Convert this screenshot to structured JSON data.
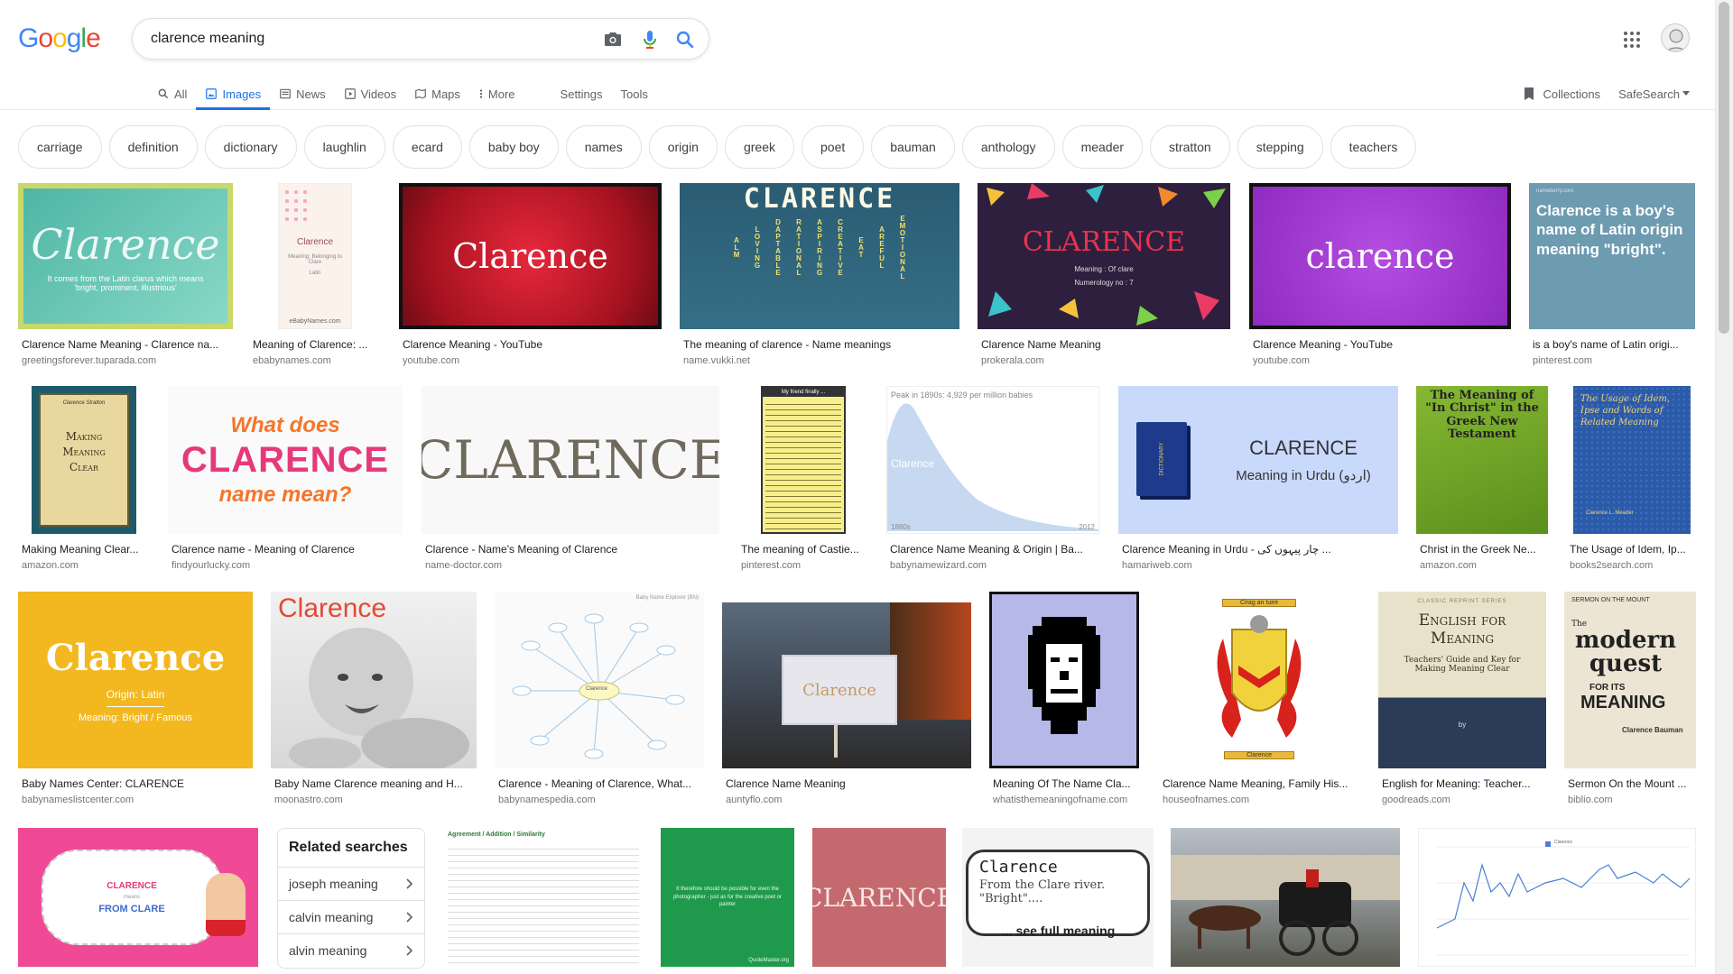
{
  "logo": {
    "letters": [
      "G",
      "o",
      "o",
      "g",
      "l",
      "e"
    ],
    "colors": [
      "#4285f4",
      "#ea4335",
      "#fbbc05",
      "#4285f4",
      "#34a853",
      "#ea4335"
    ]
  },
  "search": {
    "query": "clarence meaning"
  },
  "icons": {
    "camera": "camera-icon",
    "mic": "mic-icon",
    "search": "search-icon",
    "apps": "apps-grid-icon"
  },
  "tabs": [
    {
      "label": "All",
      "icon": "search-icon"
    },
    {
      "label": "Images",
      "icon": "image-icon",
      "active": true
    },
    {
      "label": "News",
      "icon": "news-icon"
    },
    {
      "label": "Videos",
      "icon": "video-icon"
    },
    {
      "label": "Maps",
      "icon": "map-icon"
    },
    {
      "label": "More",
      "icon": "more-icon"
    }
  ],
  "settings_label": "Settings",
  "tools_label": "Tools",
  "collections_label": "Collections",
  "safesearch_label": "SafeSearch",
  "chips": [
    "carriage",
    "definition",
    "dictionary",
    "laughlin",
    "ecard",
    "baby boy",
    "names",
    "origin",
    "greek",
    "poet",
    "bauman",
    "anthology",
    "meader",
    "stratton",
    "stepping",
    "teachers"
  ],
  "thumbs": {
    "t1_main": "Clarence",
    "t1_sub": "It comes from the Latin clarus which means 'bright, prominent, illustrious'",
    "t2_main": "Clarence",
    "t2_sub": "Meaning: Belonging to Clare",
    "t2_origin": "Latin",
    "t2_brand": "eBabyNames.com",
    "t3_main": "Clarence",
    "t4_main": "CLARENCE",
    "t4_cols": [
      "ALM",
      "LOVING",
      "DAPTABLE",
      "RATIONAL",
      "ASPIRING",
      "CREATIVE",
      "EAT",
      "AREFUL",
      "EMOTIONAL"
    ],
    "t5_main": "CLARENCE",
    "t5_l1": "Meaning : Of clare",
    "t5_l2": "Numerology no : 7",
    "t6_main": "clarence",
    "t7_brand": "nameberry.com",
    "t7_main": "Clarence is a boy's name of Latin origin meaning \"bright\".",
    "t8_series": "Clarence Stratton",
    "t8_main": "Making Meaning Clear",
    "t9_l1": "What does",
    "t9_l2": "CLARENCE",
    "t9_l3": "name mean?",
    "t10_main": "CLARENCE",
    "t11_head": "My friend finally ...",
    "t12_top": "Peak in 1890s: 4,929 per million babies",
    "t12_name": "Clarence",
    "t12_x0": "1880s",
    "t12_x1": "2012",
    "t13_main": "CLARENCE",
    "t13_sub": "Meaning in Urdu (اردو)",
    "t13_book": "DICTIONARY",
    "t14_main": "The Meaning of \"In Christ\" in the Greek New Testament",
    "t15_main": "The Usage of Idem, Ipse and Words of Related Meaning",
    "t15_author": "Clarence L. Meader",
    "t16_main": "Clarence",
    "t16_l1": "Origin: Latin",
    "t16_l2": "Meaning: Bright / Famous",
    "t17_main": "Clarence",
    "t18_head": "Baby Name Explorer (BN)",
    "t18_center": "Clarence",
    "t20_motto": "Cirag an tuire",
    "t20_name": "Clarence",
    "t21_series": "CLASSIC REPRINT SERIES",
    "t21_main": "English for Meaning",
    "t21_sub": "Teachers' Guide and Key for Making Meaning Clear",
    "t21_by": "by",
    "t22_head": "SERMON ON THE MOUNT",
    "t22_the": "The",
    "t22_main": "modern quest",
    "t22_for": "FOR ITS",
    "t22_meaning": "MEANING",
    "t22_author": "Clarence Bauman",
    "t23_main": "CLARENCE",
    "t23_l1": "means",
    "t23_l2": "FROM CLARE",
    "t24_head": "Agreement / Addition / Similarity",
    "t25_main": "It therefore should be possible for even the photographer - just as for the creative poet or painter",
    "t25_brand": "QuoteMaster.org",
    "t26_main": "CLARENCE",
    "t27_main": "Clarence",
    "t27_l1": "From the Clare river.",
    "t27_l2": "\"Bright\"....",
    "t27_more": "... see full meaning",
    "t29_legend": "Clarence"
  },
  "results": [
    {
      "title": "Clarence Name Meaning - Clarence na...",
      "site": "greetingsforever.tuparada.com"
    },
    {
      "title": "Meaning of Clarence: ...",
      "site": "ebabynames.com"
    },
    {
      "title": "Clarence Meaning - YouTube",
      "site": "youtube.com"
    },
    {
      "title": "The meaning of clarence - Name meanings",
      "site": "name.vukki.net"
    },
    {
      "title": "Clarence Name Meaning",
      "site": "prokerala.com"
    },
    {
      "title": "Clarence Meaning - YouTube",
      "site": "youtube.com"
    },
    {
      "title": "is a boy's name of Latin origi...",
      "site": "pinterest.com"
    },
    {
      "title": "Making Meaning Clear...",
      "site": "amazon.com"
    },
    {
      "title": "Clarence name - Meaning of Clarence",
      "site": "findyourlucky.com"
    },
    {
      "title": "Clarence - Name's Meaning of Clarence",
      "site": "name-doctor.com"
    },
    {
      "title": "The meaning of Castie...",
      "site": "pinterest.com"
    },
    {
      "title": "Clarence Name Meaning & Origin | Ba...",
      "site": "babynamewizard.com"
    },
    {
      "title": "Clarence Meaning in Urdu - چار پیہوں کی ...",
      "site": "hamariweb.com"
    },
    {
      "title": "Christ in the Greek Ne...",
      "site": "amazon.com"
    },
    {
      "title": "The Usage of Idem, Ip...",
      "site": "books2search.com"
    },
    {
      "title": "Baby Names Center: CLARENCE",
      "site": "babynameslistcenter.com"
    },
    {
      "title": "Baby Name Clarence meaning and H...",
      "site": "moonastro.com"
    },
    {
      "title": "Clarence - Meaning of Clarence, What...",
      "site": "babynamespedia.com"
    },
    {
      "title": "Clarence Name Meaning",
      "site": "auntyflo.com"
    },
    {
      "title": "Meaning Of The Name Cla...",
      "site": "whatisthemeaningofname.com"
    },
    {
      "title": "Clarence Name Meaning, Family His...",
      "site": "houseofnames.com"
    },
    {
      "title": "English for Meaning: Teacher...",
      "site": "goodreads.com"
    },
    {
      "title": "Sermon On the Mount ...",
      "site": "biblio.com"
    }
  ],
  "related": {
    "heading": "Related searches",
    "items": [
      "joseph meaning",
      "calvin meaning",
      "alvin meaning"
    ]
  }
}
